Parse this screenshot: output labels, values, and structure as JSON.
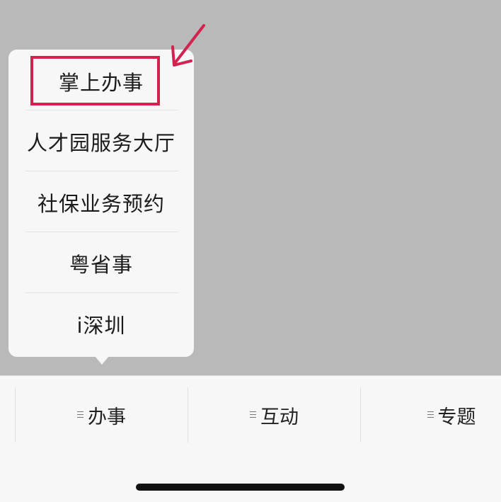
{
  "popup_menu": {
    "items": [
      {
        "label": "掌上办事"
      },
      {
        "label": "人才园服务大厅"
      },
      {
        "label": "社保业务预约"
      },
      {
        "label": "粤省事"
      },
      {
        "label": "i深圳"
      }
    ],
    "highlight_color": "#d2234f"
  },
  "tab_bar": {
    "tabs": [
      {
        "label": "办事",
        "icon": "menu-lines-icon"
      },
      {
        "label": "互动",
        "icon": "menu-lines-icon"
      },
      {
        "label": "专题",
        "icon": "menu-lines-icon"
      }
    ]
  }
}
